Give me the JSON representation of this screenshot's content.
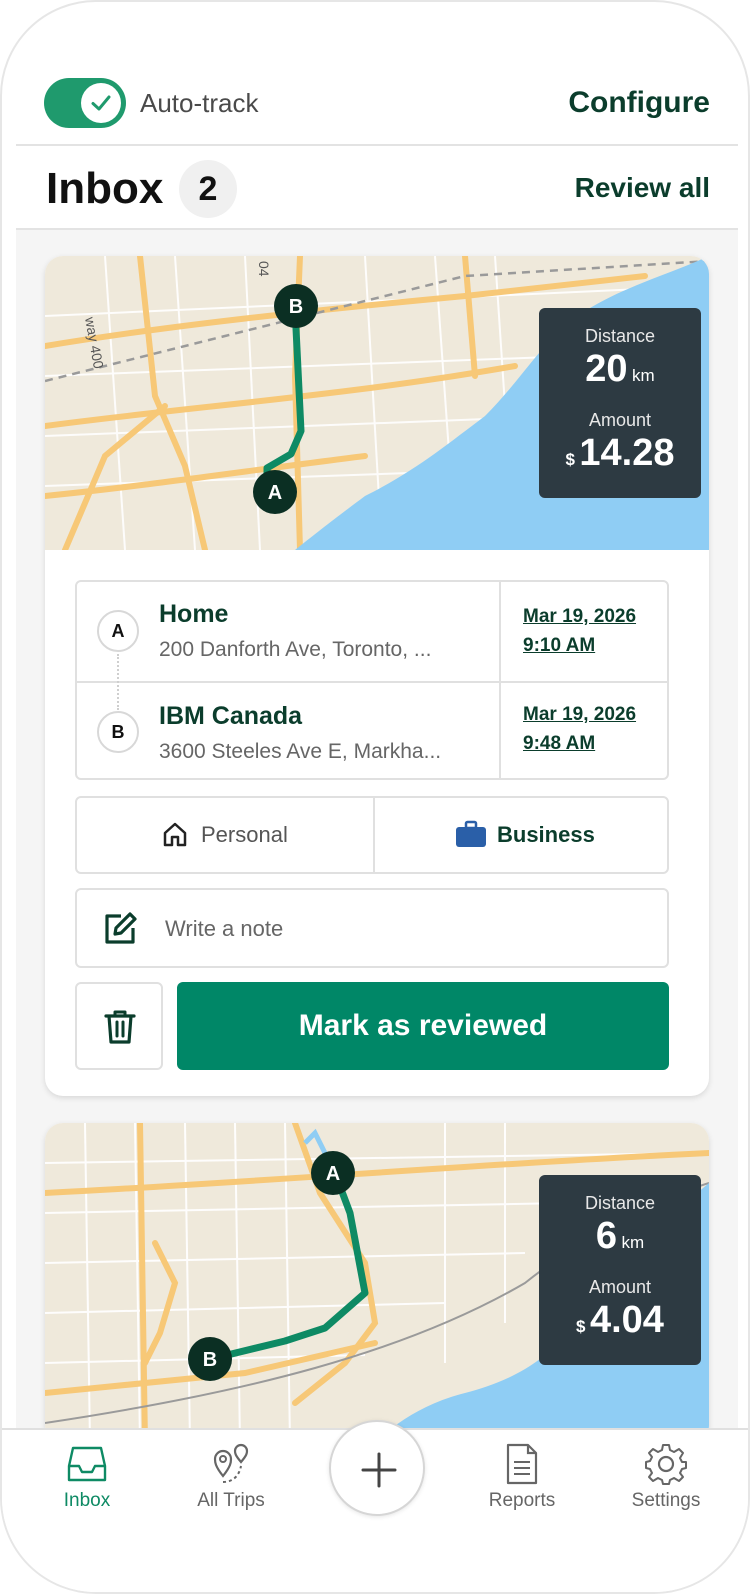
{
  "header": {
    "auto_track_label": "Auto-track",
    "auto_track_on": true,
    "configure_label": "Configure"
  },
  "inbox": {
    "title": "Inbox",
    "count": "2",
    "review_all_label": "Review all"
  },
  "map_labels": {
    "highway_400": "way 400",
    "highway_404": "04"
  },
  "trips": [
    {
      "distance_label": "Distance",
      "distance_value": "20",
      "distance_unit": "km",
      "amount_label": "Amount",
      "amount_currency": "$",
      "amount_value": "14.28",
      "start": {
        "marker": "A",
        "name": "Home",
        "address": "200 Danforth Ave, Toronto, ...",
        "date": "Mar 19, 2026",
        "time": "9:10 AM"
      },
      "end": {
        "marker": "B",
        "name": "IBM Canada",
        "address": "3600 Steeles Ave E, Markha...",
        "date": "Mar 19, 2026",
        "time": "9:48 AM"
      },
      "type_personal_label": "Personal",
      "type_business_label": "Business",
      "selected_type": "Business",
      "note_placeholder": "Write a note",
      "mark_reviewed_label": "Mark as reviewed"
    },
    {
      "distance_label": "Distance",
      "distance_value": "6",
      "distance_unit": "km",
      "amount_label": "Amount",
      "amount_currency": "$",
      "amount_value": "4.04",
      "start": {
        "marker": "A"
      },
      "end": {
        "marker": "B"
      }
    }
  ],
  "nav": {
    "inbox": "Inbox",
    "all_trips": "All Trips",
    "reports": "Reports",
    "settings": "Settings",
    "active": "Inbox"
  },
  "colors": {
    "brand_green": "#008767",
    "toggle_green": "#1f9a6d",
    "dark_green_text": "#0b3d2c",
    "route_green": "#0e8a64",
    "stats_panel": "#2d3a42",
    "water": "#8fcdf4",
    "land": "#efe9db",
    "road": "#f7c877",
    "business_blue": "#2a5fa8"
  }
}
